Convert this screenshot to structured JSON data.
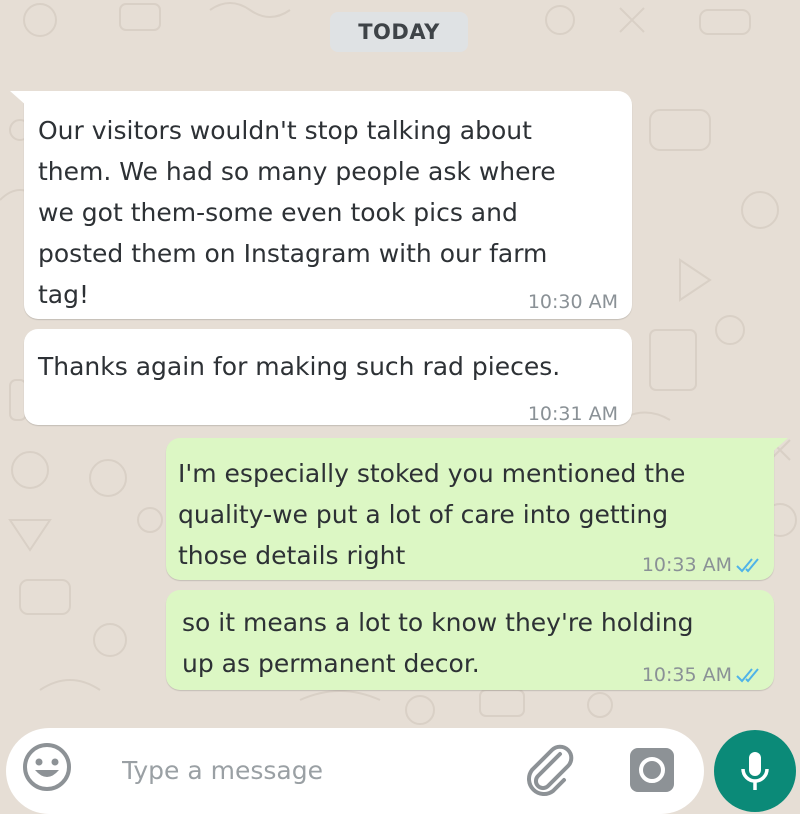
{
  "chat": {
    "date_chip": "TODAY",
    "messages": [
      {
        "direction": "incoming",
        "text": "Our visitors wouldn't stop talking about\nthem. We had so many people ask where\nwe got them-some even took pics and\nposted them on Instagram with our farm\ntag!",
        "time": "10:30 AM"
      },
      {
        "direction": "incoming",
        "text": "Thanks again for making such rad pieces.",
        "time": "10:31 AM"
      },
      {
        "direction": "outgoing",
        "text": "I'm especially stoked you mentioned the\nquality-we put a lot of care into getting\nthose details right",
        "time": "10:33 AM",
        "status": "read"
      },
      {
        "direction": "outgoing",
        "text": "so it means a lot to know they're holding\nup as permanent decor.",
        "time": "10:35 AM",
        "status": "read"
      }
    ]
  },
  "composer": {
    "placeholder": "Type a message",
    "value": "",
    "icons": {
      "emoji": "emoji-icon",
      "attach": "paperclip-icon",
      "camera": "camera-icon",
      "mic": "microphone-icon"
    }
  },
  "colors": {
    "background": "#e6ded5",
    "incoming_bubble": "#ffffff",
    "outgoing_bubble": "#dcf7c4",
    "read_ticks": "#4fb3e8",
    "mic_button": "#0b8a78",
    "timestamp": "#8a9196"
  }
}
